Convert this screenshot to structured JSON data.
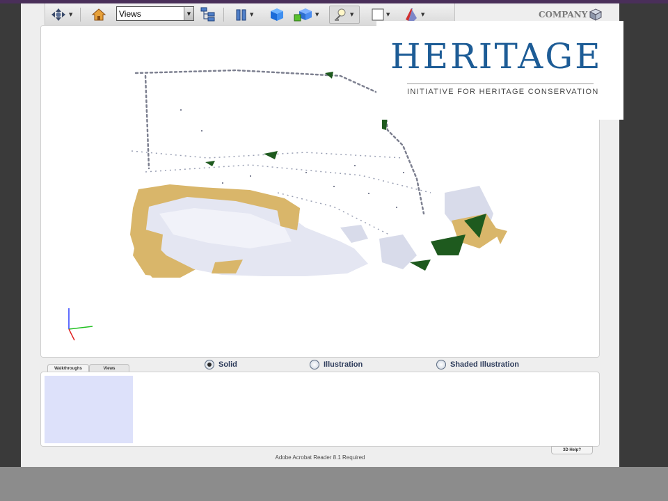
{
  "toolbar": {
    "views_select": "Views",
    "icons": [
      "navigate-icon",
      "home-icon",
      "model-tree-icon",
      "cross-section-icon",
      "3d-box-icon",
      "render-mode-icon",
      "lighting-icon",
      "background-color-icon",
      "projection-icon"
    ]
  },
  "company": {
    "label": "COMPANY"
  },
  "heritage": {
    "title": "HERITAGE",
    "subtitle": "INITIATIVE FOR HERITAGE CONSERVATION",
    "color": "#1d5c96"
  },
  "render_modes": [
    {
      "label": "Solid",
      "selected": true
    },
    {
      "label": "Illustration",
      "selected": false
    },
    {
      "label": "Shaded Illustration",
      "selected": false
    }
  ],
  "tabs": [
    {
      "label": "Walkthroughs",
      "active": true
    },
    {
      "label": "Views",
      "active": false
    }
  ],
  "help_button": "3D Help?",
  "footer_note": "Adobe Acrobat Reader 8.1 Required",
  "colors": {
    "model_surface": "#e4e6f2",
    "model_sandstone": "#d9b66a",
    "model_vegetation": "#1e5a1e",
    "thumbnail": "#dde1fa"
  }
}
